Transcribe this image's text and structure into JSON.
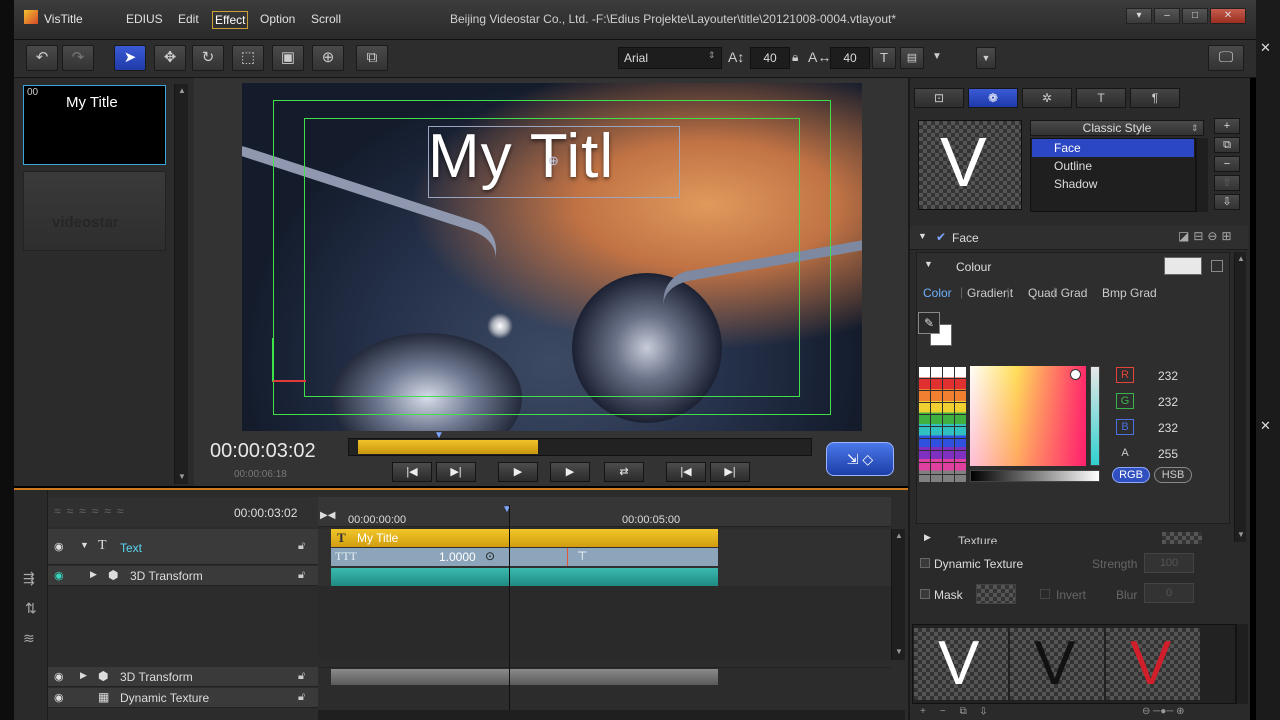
{
  "app": {
    "logo_label": "VisTitle",
    "window_title": "Beijing Videostar Co., Ltd. -F:\\Edius Projekte\\Layouter\\title\\20121008-0004.vtlayout*",
    "menu": [
      "EDIUS",
      "Edit",
      "Effect",
      "Option",
      "Scroll"
    ],
    "active_menu": "Effect"
  },
  "toolbar": {
    "font_name": "Arial",
    "font_size_1": "40",
    "font_size_2": "40"
  },
  "thumbnails": [
    {
      "index": "00",
      "label": "My Title"
    },
    {
      "index": "",
      "label": "videostar"
    }
  ],
  "preview": {
    "title_text": "My Titl",
    "timecode": "00:00:03:02",
    "duration": "00:00:06:18"
  },
  "timeline": {
    "header_timecode": "00:00:03:02",
    "ruler_start": "00:00:00:00",
    "ruler_mid": "00:00:05:00",
    "tracks": [
      {
        "label": "Text",
        "icon": "text-icon"
      },
      {
        "label": "3D Transform",
        "icon": "cube-icon"
      }
    ],
    "clip_label": "My Title",
    "keyframe_value": "1.0000",
    "lower_tracks": [
      {
        "label": "3D Transform"
      },
      {
        "label": "Dynamic Texture"
      }
    ]
  },
  "right_panel": {
    "style_dropdown": "Classic Style",
    "style_items": [
      "Face",
      "Outline",
      "Shadow"
    ],
    "selected_style": "Face",
    "preview_letter": "V",
    "face_section_label": "Face",
    "colour_label": "Colour",
    "colour_tabs": [
      "Color",
      "Gradient",
      "Quad Grad",
      "Bmp Grad"
    ],
    "active_colour_tab": "Color",
    "channels": [
      {
        "name": "R",
        "value": "232",
        "color": "#e0443a"
      },
      {
        "name": "G",
        "value": "232",
        "color": "#3bb34a"
      },
      {
        "name": "B",
        "value": "232",
        "color": "#4a72e0"
      },
      {
        "name": "A",
        "value": "255",
        "color": "#cccccc"
      }
    ],
    "mode_buttons": [
      "RGB",
      "HSB"
    ],
    "texture_label": "Texture",
    "dynamic_texture_label": "Dynamic Texture",
    "strength_label": "Strength",
    "strength_value": "100",
    "mask_label": "Mask",
    "invert_label": "Invert",
    "blur_label": "Blur",
    "blur_value": "0",
    "style_previews": [
      {
        "letter": "V",
        "color": "#ffffff"
      },
      {
        "letter": "V",
        "color": "#111111"
      },
      {
        "letter": "V",
        "color": "#d01e2a"
      }
    ]
  },
  "colors": {
    "accent_blue": "#2c47c4",
    "timeline_border": "#d07a1e",
    "clip_yellow": "#e8b81c",
    "clip_teal": "#2aa39a",
    "guide_green": "#3fe04a"
  }
}
